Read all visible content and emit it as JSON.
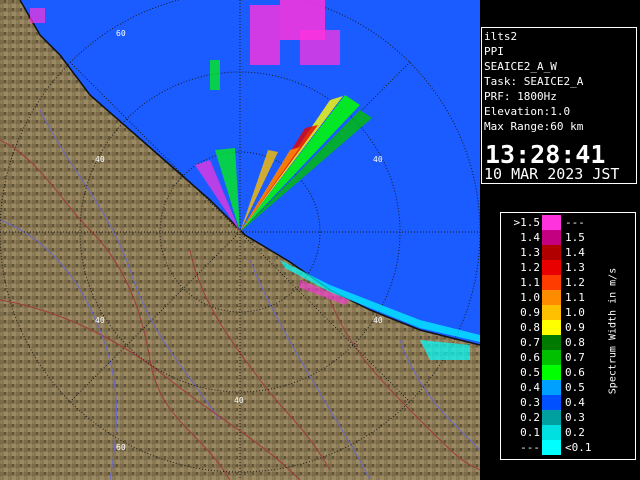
{
  "info": {
    "lines": [
      "ilts2",
      "PPI",
      "SEAICE2_A_W",
      "Task: SEAICE2_A",
      "PRF: 1800Hz",
      "Elevation:1.0",
      "Max Range:60 km"
    ],
    "time": "13:28:41",
    "date": "10 MAR 2023 JST"
  },
  "legend": {
    "title": "Spectrum Width in m/s",
    "rows": [
      {
        "lo": ">1.5",
        "hi": "---",
        "color": "#ff33dd"
      },
      {
        "lo": "1.4",
        "hi": "1.5",
        "color": "#c30080"
      },
      {
        "lo": "1.3",
        "hi": "1.4",
        "color": "#b00000"
      },
      {
        "lo": "1.2",
        "hi": "1.3",
        "color": "#e80000"
      },
      {
        "lo": "1.1",
        "hi": "1.2",
        "color": "#ff3c00"
      },
      {
        "lo": "1.0",
        "hi": "1.1",
        "color": "#ff8c00"
      },
      {
        "lo": "0.9",
        "hi": "1.0",
        "color": "#ffc000"
      },
      {
        "lo": "0.8",
        "hi": "0.9",
        "color": "#ffff00"
      },
      {
        "lo": "0.7",
        "hi": "0.8",
        "color": "#007a00"
      },
      {
        "lo": "0.6",
        "hi": "0.7",
        "color": "#00c000"
      },
      {
        "lo": "0.5",
        "hi": "0.6",
        "color": "#00ff00"
      },
      {
        "lo": "0.4",
        "hi": "0.5",
        "color": "#00a0ff"
      },
      {
        "lo": "0.3",
        "hi": "0.4",
        "color": "#0050ff"
      },
      {
        "lo": "0.2",
        "hi": "0.3",
        "color": "#00a0a0"
      },
      {
        "lo": "0.1",
        "hi": "0.2",
        "color": "#00e0e0"
      },
      {
        "lo": "---",
        "hi": "<0.1",
        "color": "#00ffff"
      }
    ]
  },
  "map": {
    "sea_color": "#1a5cff",
    "land_color": "#8a7a55",
    "range_labels": [
      "60",
      "40",
      "40",
      "40",
      "40",
      "40",
      "60"
    ]
  }
}
